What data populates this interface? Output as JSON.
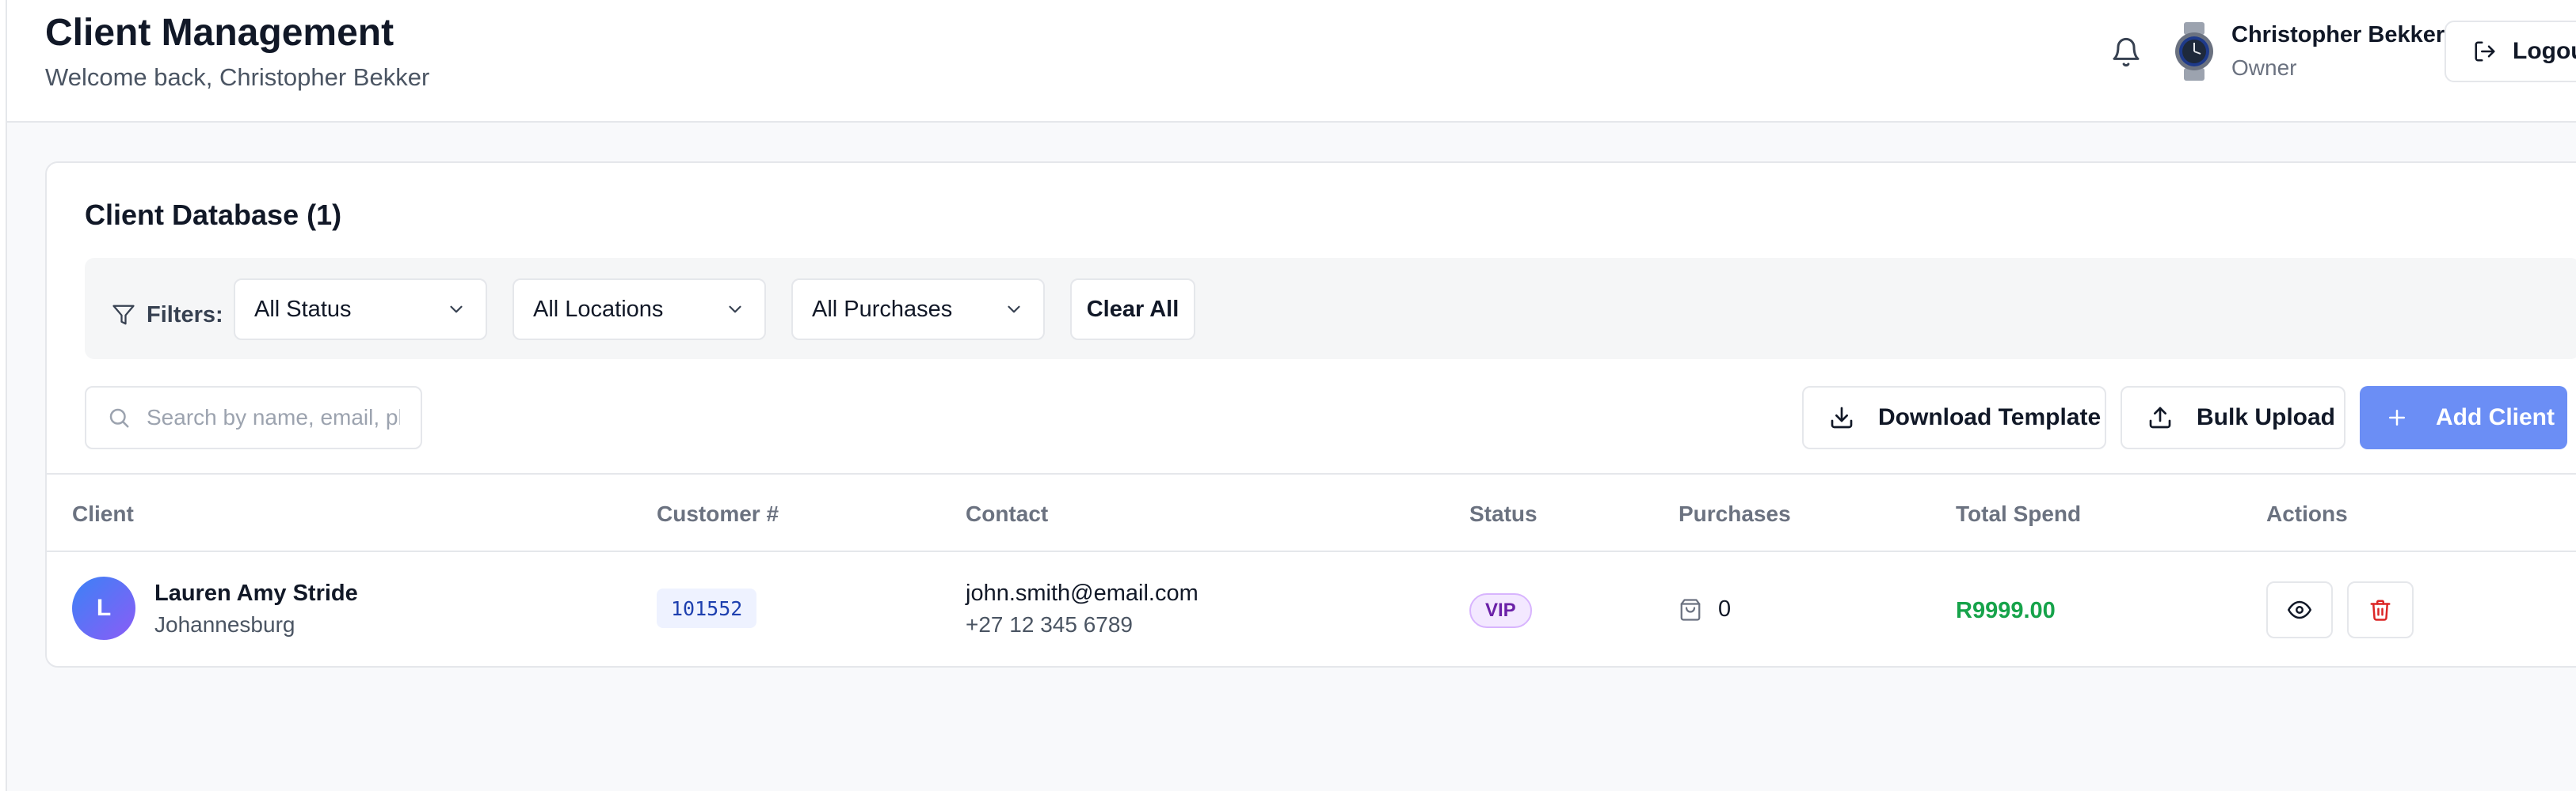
{
  "header": {
    "title": "Client Management",
    "subtitle": "Welcome back, Christopher Bekker",
    "user": {
      "name": "Christopher Bekker",
      "role": "Owner"
    },
    "logout_label": "Logout"
  },
  "card": {
    "title": "Client Database (1)",
    "filters": {
      "label": "Filters:",
      "status": "All Status",
      "locations": "All Locations",
      "purchases": "All Purchases",
      "clear_label": "Clear All"
    },
    "search": {
      "placeholder": "Search by name, email, phone"
    },
    "actions": {
      "download_template": "Download Template",
      "bulk_upload": "Bulk Upload",
      "add_client": "Add Client"
    },
    "table": {
      "columns": [
        "Client",
        "Customer #",
        "Contact",
        "Status",
        "Purchases",
        "Total Spend",
        "Actions"
      ],
      "rows": [
        {
          "initial": "L",
          "name": "Lauren Amy Stride",
          "location": "Johannesburg",
          "customer_no": "101552",
          "email": "john.smith@email.com",
          "phone": "+27 12 345 6789",
          "status": "VIP",
          "purchases": "0",
          "total_spend": "R9999.00"
        }
      ]
    }
  },
  "colors": {
    "accent": "#6b8ef5",
    "vip_badge": "#f3e8ff",
    "spend_green": "#16a34a",
    "delete_red": "#dc2626"
  },
  "icons": [
    "bell-icon",
    "logout-icon",
    "filter-icon",
    "chevron-down-icon",
    "search-icon",
    "download-icon",
    "upload-icon",
    "plus-icon",
    "shopping-bag-icon",
    "eye-icon",
    "trash-icon"
  ]
}
